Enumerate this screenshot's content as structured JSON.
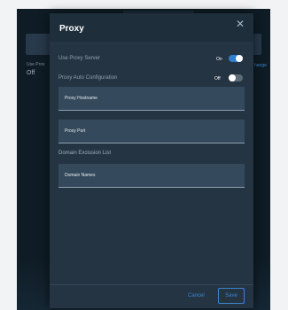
{
  "background": {
    "use_proxy_label": "Use Prox",
    "use_proxy_value": "Off",
    "change_link": "hange"
  },
  "dialog": {
    "title": "Proxy",
    "close_icon": "close-icon",
    "use_proxy_server": {
      "label": "Use Proxy Server",
      "state": "On"
    },
    "proxy_auto_config": {
      "label": "Proxy Auto Configuration",
      "state": "Off"
    },
    "hostname_placeholder": "Proxy Hostname",
    "port_placeholder": "Proxy Port",
    "domain_section_label": "Domain Exclusion List",
    "domain_placeholder": "Domain Names",
    "cancel_label": "Cancel",
    "save_label": "Save"
  },
  "colors": {
    "accent": "#2f7fcf",
    "dialog_bg": "#243443",
    "page_bg": "#0f1c25"
  }
}
